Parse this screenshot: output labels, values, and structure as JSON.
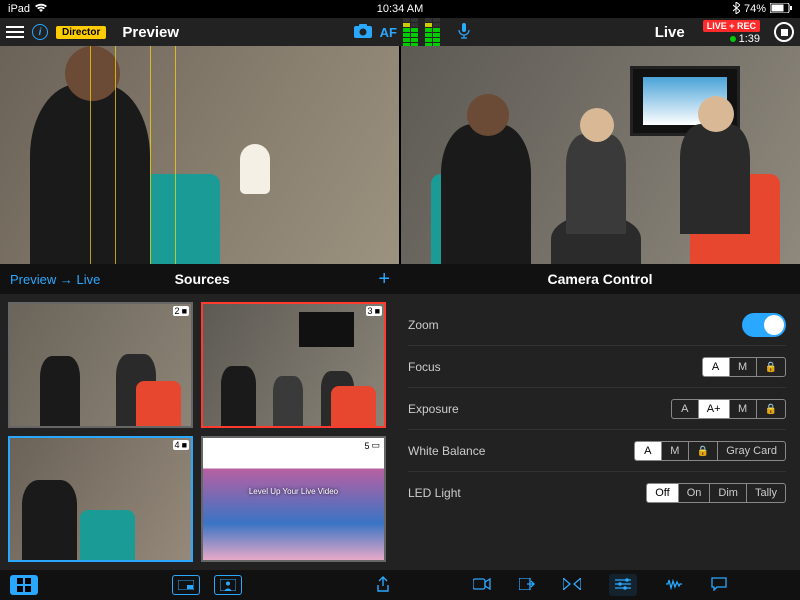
{
  "statusbar": {
    "device": "iPad",
    "time": "10:34 AM",
    "battery": "74%"
  },
  "topbar": {
    "director_badge": "Director",
    "preview_label": "Preview",
    "af_label": "AF",
    "live_label": "Live",
    "liverec_badge": "LIVE + REC",
    "timer": "1:39"
  },
  "midbar": {
    "preview_to_live": "Preview → Live",
    "sources": "Sources",
    "camera_control": "Camera Control"
  },
  "sources": {
    "thumbs": [
      {
        "id": "2",
        "selected": "none"
      },
      {
        "id": "3",
        "selected": "red"
      },
      {
        "id": "4",
        "selected": "blue"
      },
      {
        "id": "5",
        "selected": "none",
        "banner": "Level Up Your Live Video"
      }
    ]
  },
  "camera_control": {
    "rows": {
      "zoom": "Zoom",
      "focus": "Focus",
      "exposure": "Exposure",
      "white_balance": "White Balance",
      "led": "LED Light"
    },
    "focus_opts": {
      "a": "A",
      "m": "M"
    },
    "exposure_opts": {
      "a": "A",
      "ap": "A+",
      "m": "M"
    },
    "wb_opts": {
      "a": "A",
      "m": "M",
      "gray": "Gray Card"
    },
    "led_opts": {
      "off": "Off",
      "on": "On",
      "dim": "Dim",
      "tally": "Tally"
    }
  },
  "icons": {
    "camera": "📷",
    "mic": "🎤",
    "video": "📹",
    "share": "⇪"
  }
}
